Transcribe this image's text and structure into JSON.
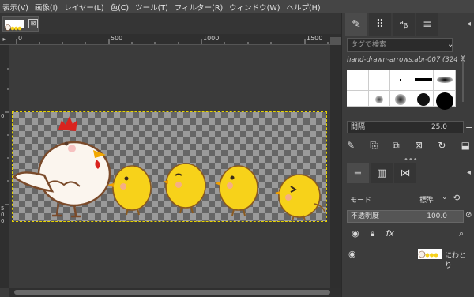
{
  "menu": [
    "表示(V)",
    "画像(I)",
    "レイヤー(L)",
    "色(C)",
    "ツール(T)",
    "フィルター(R)",
    "ウィンドウ(W)",
    "ヘルプ(H)"
  ],
  "tab": {
    "close": "⊠"
  },
  "ruler": {
    "h_labels": [
      "0",
      "500",
      "1000",
      "1500"
    ],
    "v_labels": [
      "0",
      "5",
      "0",
      "0"
    ]
  },
  "brushes": {
    "tag_placeholder": "タグで検索",
    "brush_name": "hand-drawn-arrows.abr-007 (324 ×",
    "spacing_label": "間隔",
    "spacing_value": "25.0"
  },
  "layers": {
    "mode_label": "モード",
    "mode_value": "標準",
    "opacity_label": "不透明度",
    "opacity_value": "100.0",
    "layer_name": "にわとり"
  },
  "colors": {
    "hen_comb": "#d9231e",
    "chick": "#f7d21a",
    "selection": "#e6d200"
  }
}
